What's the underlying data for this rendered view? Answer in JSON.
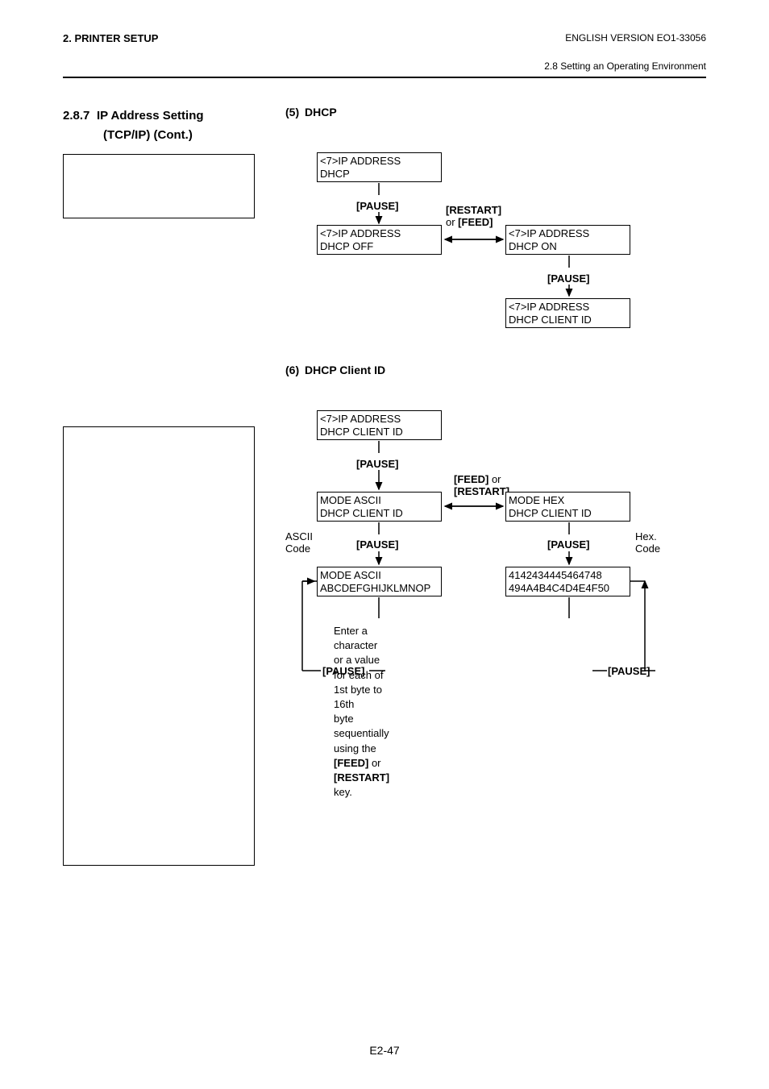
{
  "header": {
    "left": "2. PRINTER SETUP",
    "right": "ENGLISH VERSION EO1-33056",
    "sub": "2.8 Setting an Operating Environment"
  },
  "section": {
    "number": "2.8.7",
    "title_line1": "IP Address Setting",
    "title_line2": "(TCP/IP) (Cont.)"
  },
  "sub5": {
    "number": "(5)",
    "title": "DHCP",
    "box1_line1": "<7>IP ADDRESS",
    "box1_line2": "DHCP",
    "box2_line1": "<7>IP ADDRESS",
    "box2_line2": "DHCP     OFF",
    "box3_line1": "<7>IP ADDRESS",
    "box3_line2": "DHCP     ON",
    "box4_line1": "<7>IP ADDRESS",
    "box4_line2": "DHCP CLIENT ID",
    "pause": "[PAUSE]",
    "restart_or_feed_1": "[RESTART]",
    "restart_or_feed_or": " or ",
    "restart_or_feed_2": "[FEED]"
  },
  "sub6": {
    "number": "(6)",
    "title": "DHCP Client ID",
    "box1_line1": "<7>IP ADDRESS",
    "box1_line2": "DHCP CLIENT ID",
    "box2_line1": "MODE     ASCII",
    "box2_line2": "DHCP CLIENT ID",
    "box3_line1": "MODE     HEX",
    "box3_line2": "DHCP CLIENT ID",
    "box4_line1": "MODE     ASCII",
    "box4_line2": "ABCDEFGHIJKLMNOP",
    "box5_line1": "4142434445464748",
    "box5_line2": "494A4B4C4D4E4F50",
    "pause": "[PAUSE]",
    "feed_or_restart_1": "[FEED]",
    "feed_or_restart_or": " or ",
    "feed_or_restart_2": "[RESTART]",
    "ascii_code": "ASCII Code",
    "hex_code": "Hex. Code",
    "note_line1": "Enter a character or a value for each of 1st byte to 16th",
    "note_line2": "byte sequentially using the ",
    "note_feed": "[FEED]",
    "note_or": " or ",
    "note_restart": "[RESTART]",
    "note_end": " key."
  },
  "page_number": "E2-47"
}
